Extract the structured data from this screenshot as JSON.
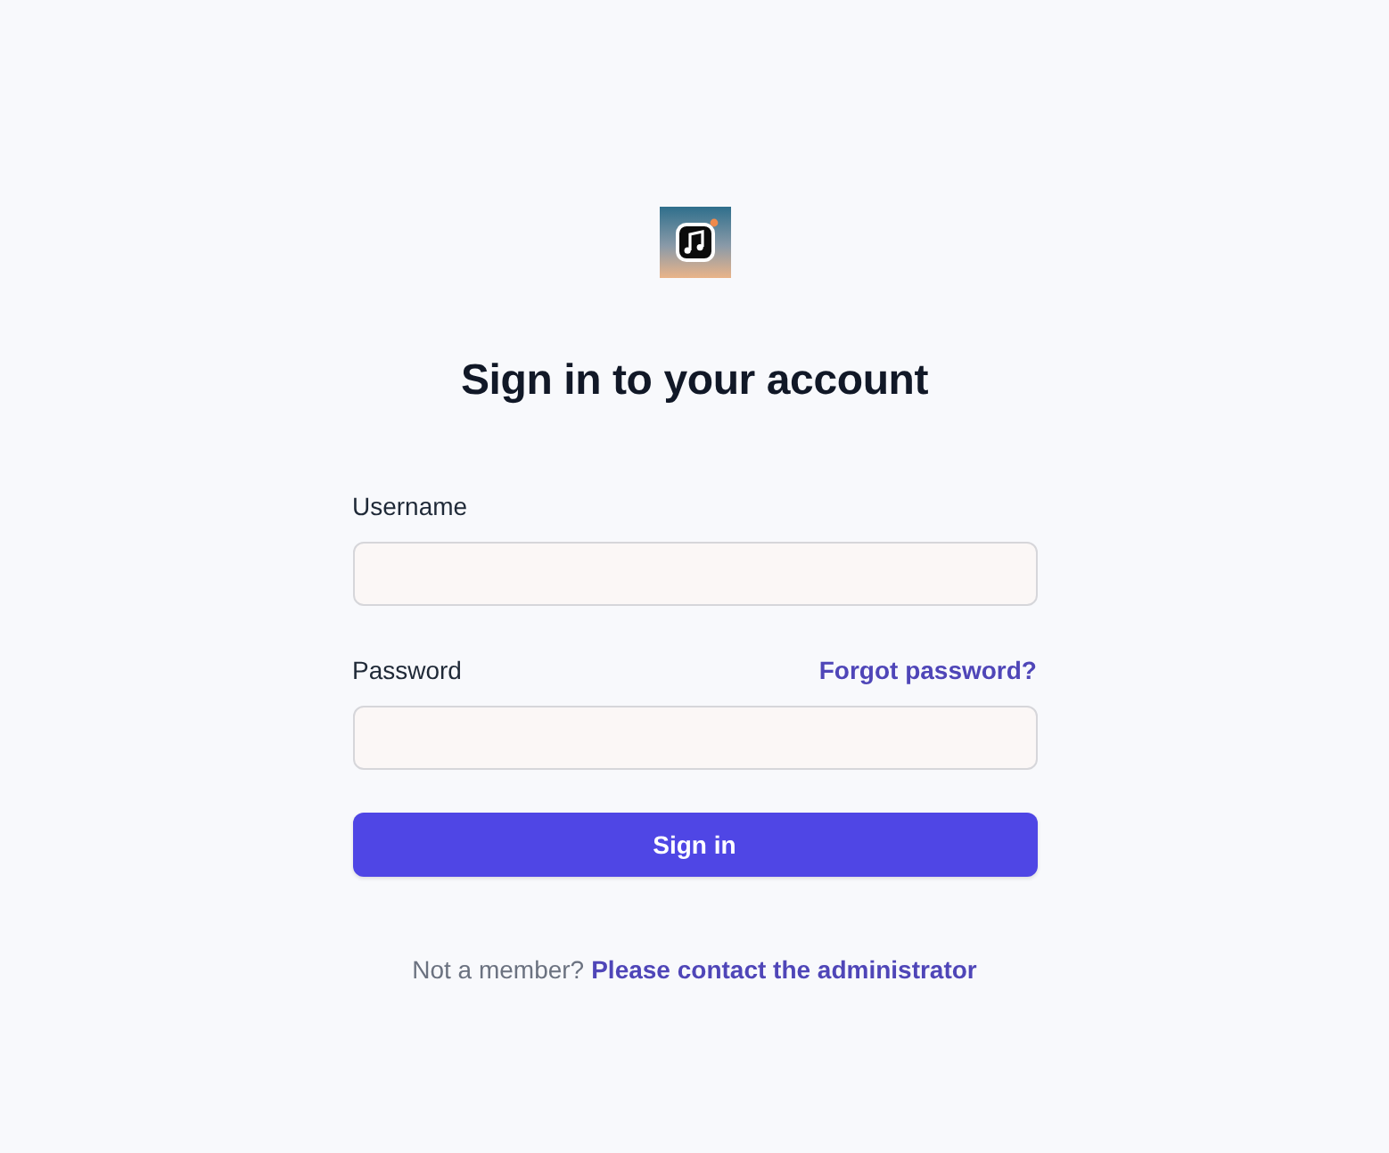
{
  "title": "Sign in to your account",
  "fields": [
    {
      "label": "Username"
    },
    {
      "label": "Password",
      "link": "Forgot password?"
    }
  ],
  "submit": {
    "label": "Sign in"
  },
  "footer": {
    "text": "Not a member?",
    "link": "Please contact the administrator"
  }
}
